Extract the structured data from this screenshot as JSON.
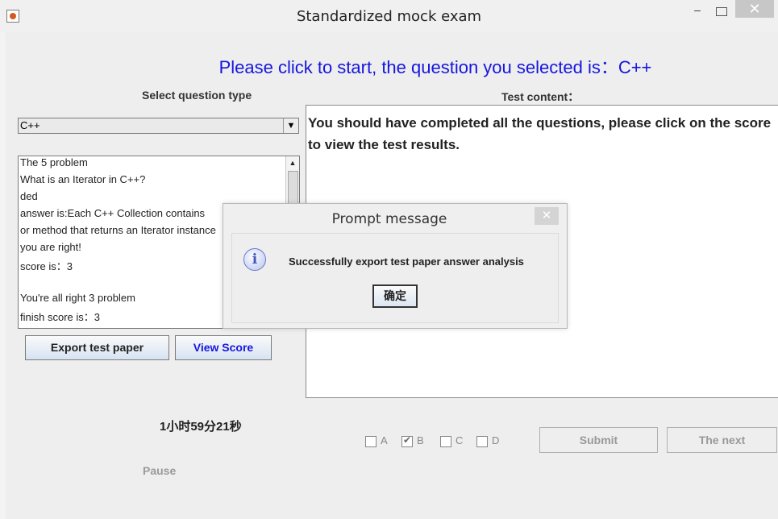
{
  "window": {
    "title": "Standardized mock exam",
    "icons": {
      "app": "java-cup-icon",
      "minimize": "minimize-icon",
      "maximize": "maximize-icon",
      "close": "close-icon"
    },
    "minimize_glyph": "–",
    "close_glyph": "✕"
  },
  "header": {
    "headline": "Please click to start, the question you selected is：C++",
    "headline_color": "#1515e0"
  },
  "left_panel": {
    "select_label": "Select question type",
    "selected_type": "C++",
    "log_lines": [
      "The 5 problem",
      "What is an Iterator in C++?",
      "ded",
      "answer is:Each C++ Collection contains",
      "or method that returns an Iterator instance",
      "you are right!",
      "score is：3",
      "",
      "You're all right 3 problem",
      "finish score is：3"
    ],
    "export_label": "Export test paper",
    "view_score_label": "View Score",
    "view_score_color": "#1515e0",
    "timer": "1小时59分21秒",
    "pause_label": "Pause"
  },
  "right_panel": {
    "content_label": "Test content：",
    "content_text": "You should have completed all the questions, please click on the score to view the test results."
  },
  "answers": {
    "options": [
      {
        "label": "A",
        "checked": false
      },
      {
        "label": "B",
        "checked": true
      },
      {
        "label": "C",
        "checked": false
      },
      {
        "label": "D",
        "checked": false
      }
    ],
    "submit_label": "Submit",
    "next_label": "The next"
  },
  "dialog": {
    "title": "Prompt message",
    "message": "Successfully export test paper answer analysis",
    "ok_label": "确定",
    "icon": "info-icon",
    "close_glyph": "✕"
  }
}
